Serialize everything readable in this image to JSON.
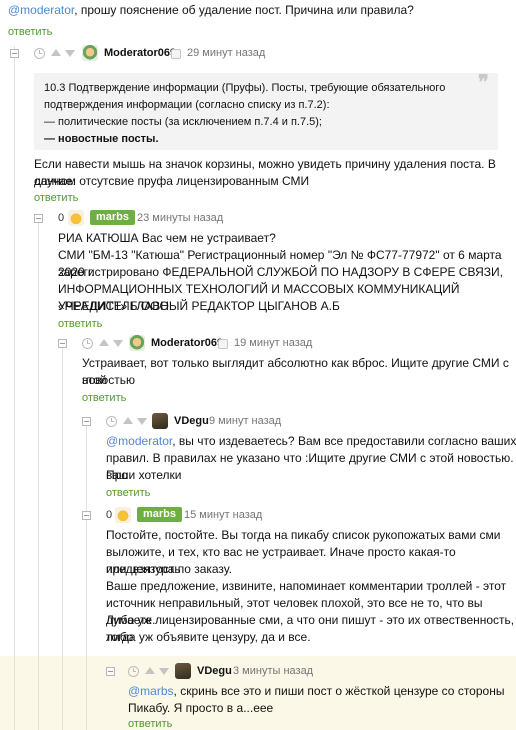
{
  "reply_label": "ответить",
  "c0": {
    "mention": "@moderator",
    "text": ", прошу пояснение об удаление пост. Причина или правила?"
  },
  "c1": {
    "user": "Moderator069",
    "time": "29 минут назад",
    "quote": [
      "10.3 Подтверждение информации (Пруфы). Посты, требующие обязательного",
      "подтверждения информации (согласно списку из п.7.2):",
      "— политические посты (за исключением п.7.4 и п.7.5);",
      "— новостные посты."
    ],
    "lines": [
      "Если навести мышь на значок корзины, можно увидеть причину удаления поста. В данном",
      "случае: отсутсвие пруфа лицензированным СМИ"
    ]
  },
  "c2": {
    "rating": "0",
    "user": "marbs",
    "time": "23 минуты назад",
    "lines": [
      "РИА КАТЮША Вас чем не устраивает?",
      "СМИ \"БМ-13 \"Катюша\" Регистрационный номер \"Эл № ФС77-77972\" от 6 марта 2020 г.",
      "зарегистрировано ФЕДЕРАЛЬНОЙ СЛУЖБОЙ ПО НАДЗОРУ В СФЕРЕ СВЯЗИ,",
      "ИНФОРМАЦИОННЫХ ТЕХНОЛОГИЙ И МАССОВЫХ КОММУНИКАЦИЙ УЧРЕДИТЕЛЬ ООО",
      "«РЕАЛИСТ» ГЛАВНЫЙ РЕДАКТОР ЦЫГАНОВ А.Б"
    ]
  },
  "c3": {
    "user": "Moderator069",
    "time": "19 минут назад",
    "lines": [
      "Устраивает, вот только выглядит абсолютно как вброс. Ищите другие СМИ с этой",
      "новостью"
    ]
  },
  "c4": {
    "user": "VDegu",
    "time": "9 минут назад",
    "mention": "@moderator",
    "first_line": ", вы что издеваетесь? Вам все предоставили согласно ваших",
    "lines": [
      "правил. В правилах не указано что :Ищите другие СМИ с этой новостью. Про",
      "ваши хотелки"
    ]
  },
  "c5": {
    "rating": "0",
    "user": "marbs",
    "time": "15 минут назад",
    "lines": [
      "Постойте, постойте. Вы тогда на пикабу список рукопожатых вами сми",
      "выложите, и тех, кто вас не устраивает. Иначе просто какая-то предвзятость",
      "или цензура по заказу.",
      "Ваше предложение, извините, напоминает комментарии троллей - этот",
      "источник неправильный, этот человек плохой, это все не то, что вы думаете.",
      "Либо уж лицензированные сми, а что они пишут - это их отвественность, либо",
      "тогда уж объявите цензуру, да и все."
    ]
  },
  "c6": {
    "user": "VDegu",
    "time": "3 минуты назад",
    "mention": "@marbs",
    "first_line": ", скринь все это и пиши пост о жёсткой цензуре со стороны",
    "lines": [
      "Пикабу. Я просто в а...еее"
    ]
  }
}
